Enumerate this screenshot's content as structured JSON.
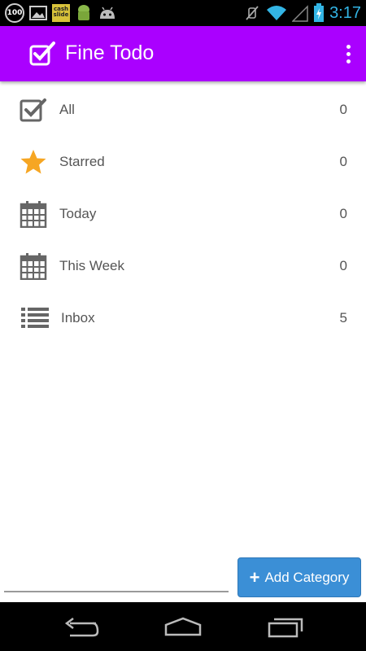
{
  "status_bar": {
    "badge_100": "100",
    "cash_text": "cash slide",
    "time": "3:17"
  },
  "app_bar": {
    "title": "Fine Todo",
    "color": "#aa00ff"
  },
  "categories": [
    {
      "label": "All",
      "count": "0",
      "icon": "checkbox-icon"
    },
    {
      "label": "Starred",
      "count": "0",
      "icon": "star-icon"
    },
    {
      "label": "Today",
      "count": "0",
      "icon": "calendar-icon"
    },
    {
      "label": "This Week",
      "count": "0",
      "icon": "calendar-icon"
    },
    {
      "label": "Inbox",
      "count": "5",
      "icon": "list-icon"
    }
  ],
  "footer": {
    "add_button_label": "Add Category",
    "button_color": "#3b8fd6"
  },
  "colors": {
    "star": "#f6a623",
    "icon_gray": "#666666"
  }
}
